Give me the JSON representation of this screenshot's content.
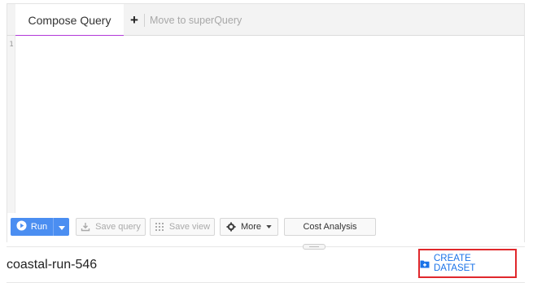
{
  "tabs": {
    "active_label": "Compose Query",
    "add_symbol": "+",
    "move_label": "Move to superQuery"
  },
  "editor": {
    "line_numbers": [
      "1"
    ]
  },
  "toolbar": {
    "run_label": "Run",
    "save_query_label": "Save query",
    "save_view_label": "Save view",
    "more_label": "More",
    "cost_analysis_label": "Cost Analysis"
  },
  "project": {
    "name": "coastal-run-546",
    "create_dataset_label": "CREATE DATASET"
  },
  "colors": {
    "tab_underline": "#b23ad9",
    "run_button": "#4b8ef1",
    "link_blue": "#1a73e8",
    "highlight_red": "#e0282c"
  },
  "icons": {
    "run": "play-circle-icon",
    "run_dropdown": "caret-down-icon",
    "save_query": "download-icon",
    "save_view": "grid-view-icon",
    "more": "gear-icon",
    "create_dataset": "folder-plus-icon"
  }
}
